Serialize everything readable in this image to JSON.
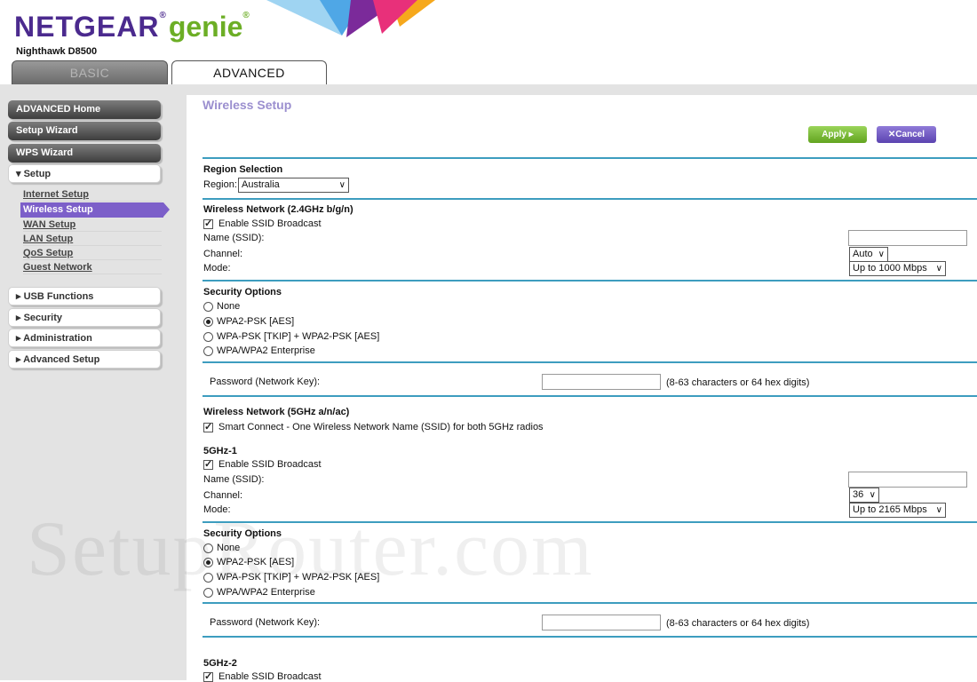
{
  "header": {
    "logo_brand": "NETGEAR",
    "logo_product": "genie",
    "logo_reg": "®",
    "model": "Nighthawk D8500",
    "tabs": [
      {
        "label": "BASIC"
      },
      {
        "label": "ADVANCED"
      }
    ]
  },
  "sidebar": {
    "top_buttons": [
      {
        "label": "ADVANCED Home"
      },
      {
        "label": "Setup Wizard"
      },
      {
        "label": "WPS Wizard"
      }
    ],
    "setup_section": {
      "label": "▾ Setup"
    },
    "setup_items": [
      {
        "label": "Internet Setup"
      },
      {
        "label": "Wireless Setup"
      },
      {
        "label": "WAN Setup"
      },
      {
        "label": "LAN Setup"
      },
      {
        "label": "QoS Setup"
      },
      {
        "label": "Guest Network"
      }
    ],
    "collapsed_sections": [
      {
        "label": "▸ USB Functions"
      },
      {
        "label": "▸ Security"
      },
      {
        "label": "▸ Administration"
      },
      {
        "label": "▸ Advanced Setup"
      }
    ]
  },
  "main": {
    "title": "Wireless Setup",
    "apply_label": "Apply ▸",
    "cancel_label": "✕Cancel",
    "region": {
      "heading": "Region Selection",
      "label": "Region:",
      "value": "Australia"
    },
    "net24": {
      "heading": "Wireless Network (2.4GHz b/g/n)",
      "ssid_broadcast": "Enable SSID Broadcast",
      "name_label": "Name (SSID):",
      "channel_label": "Channel:",
      "channel_value": "Auto",
      "mode_label": "Mode:",
      "mode_value": "Up to 1000 Mbps",
      "security_heading": "Security Options",
      "options": [
        "None",
        "WPA2-PSK [AES]",
        "WPA-PSK [TKIP] + WPA2-PSK [AES]",
        "WPA/WPA2 Enterprise"
      ],
      "password_label": "Password (Network Key):",
      "password_hint": "(8-63 characters or 64 hex digits)"
    },
    "net5": {
      "heading": "Wireless Network (5GHz a/n/ac)",
      "smart_connect": "Smart Connect - One Wireless Network Name (SSID) for both 5GHz radios",
      "radio1": {
        "heading": "5GHz-1",
        "ssid_broadcast": "Enable SSID Broadcast",
        "name_label": "Name (SSID):",
        "channel_label": "Channel:",
        "channel_value": "36",
        "mode_label": "Mode:",
        "mode_value": "Up to 2165 Mbps",
        "security_heading": "Security Options",
        "options": [
          "None",
          "WPA2-PSK [AES]",
          "WPA-PSK [TKIP] + WPA2-PSK [AES]",
          "WPA/WPA2 Enterprise"
        ],
        "password_label": "Password (Network Key):",
        "password_hint": "(8-63 characters or 64 hex digits)"
      },
      "radio2": {
        "heading": "5GHz-2",
        "ssid_broadcast": "Enable SSID Broadcast"
      }
    },
    "watermark": "SetupRouter.com"
  },
  "colors": {
    "accent_line": "#3d9dbf",
    "active_nav": "#7c5fc9",
    "apply": "#62a41f",
    "cancel": "#5b43b0"
  }
}
